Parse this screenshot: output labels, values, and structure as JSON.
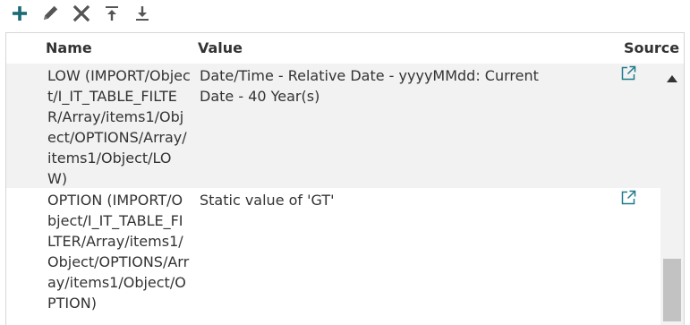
{
  "toolbar": {
    "add": {
      "icon": "plus-icon",
      "color": "#1b6b74"
    },
    "edit": {
      "icon": "pencil-icon",
      "color": "#555555"
    },
    "delete": {
      "icon": "close-icon",
      "color": "#555555"
    },
    "move_top": {
      "icon": "arrow-to-top-icon",
      "color": "#555555"
    },
    "move_bottom": {
      "icon": "arrow-to-bottom-icon",
      "color": "#555555"
    }
  },
  "table": {
    "columns": {
      "name": "Name",
      "value": "Value",
      "source": "Source"
    },
    "rows": [
      {
        "name": "LOW (IMPORT/Object/I_IT_TABLE_FILTER/Array/items1/Object/OPTIONS/Array/items1/Object/LOW)",
        "value": "Date/Time - Relative Date - yyyyMMdd: Current Date - 40 Year(s)",
        "source_icon": "external-link-icon"
      },
      {
        "name": "OPTION (IMPORT/Object/I_IT_TABLE_FILTER/Array/items1/Object/OPTIONS/Array/items1/Object/OPTION)",
        "value": "Static value of 'GT'",
        "source_icon": "external-link-icon"
      }
    ]
  },
  "colors": {
    "accent": "#1f7a8c",
    "row_alt": "#f2f2f2",
    "border": "#d6d6d6"
  }
}
